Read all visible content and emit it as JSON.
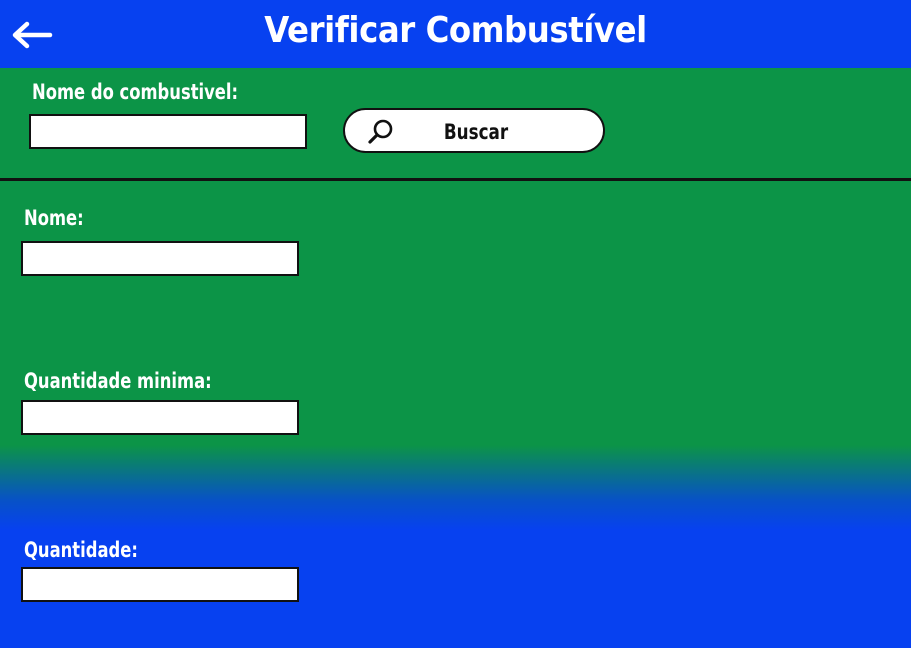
{
  "header": {
    "title": "Verificar Combustível",
    "back_icon": "arrow-left-icon"
  },
  "search": {
    "label": "Nome do combustivel:",
    "input_value": "",
    "button_label": "Buscar",
    "button_icon": "search-icon"
  },
  "details": {
    "nome_label": "Nome:",
    "nome_value": "",
    "quantidade_minima_label": "Quantidade minima:",
    "quantidade_minima_value": "",
    "quantidade_label": "Quantidade:",
    "quantidade_value": ""
  },
  "colors": {
    "header_blue": "#0741f0",
    "panel_green": "#0c9447",
    "text_white": "#ffffff"
  }
}
